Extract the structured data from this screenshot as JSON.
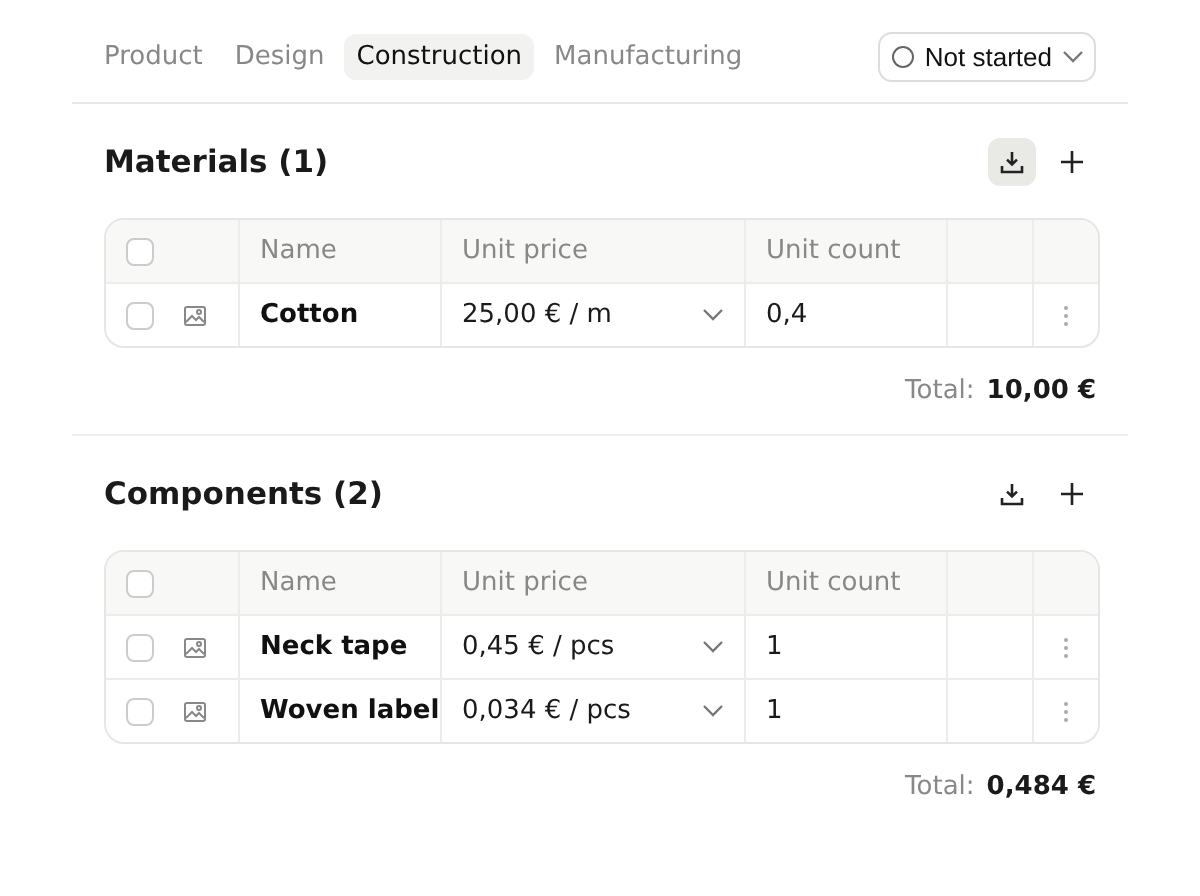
{
  "tabs": [
    {
      "label": "Product",
      "selected": false
    },
    {
      "label": "Design",
      "selected": false
    },
    {
      "label": "Construction",
      "selected": true
    },
    {
      "label": "Manufacturing",
      "selected": false
    }
  ],
  "status": {
    "label": "Not started"
  },
  "sections": [
    {
      "title": "Materials (1)",
      "download_highlighted": true,
      "table": {
        "header_checked": false,
        "columns": [
          "Name",
          "Unit price",
          "Unit count"
        ],
        "rows": [
          {
            "checked": false,
            "name": "Cotton",
            "unit_price": "25,00 € / m",
            "unit_count": "0,4"
          }
        ]
      },
      "total_label": "Total:",
      "total": "10,00 €"
    },
    {
      "title": "Components (2)",
      "download_highlighted": false,
      "table": {
        "header_checked": false,
        "columns": [
          "Name",
          "Unit price",
          "Unit count"
        ],
        "rows": [
          {
            "checked": false,
            "name": "Neck tape",
            "unit_price": "0,45 € / pcs",
            "unit_count": "1"
          },
          {
            "checked": false,
            "name": "Woven label",
            "unit_price": "0,034 € / pcs",
            "unit_count": "1"
          }
        ]
      },
      "total_label": "Total:",
      "total": "0,484 €"
    }
  ]
}
